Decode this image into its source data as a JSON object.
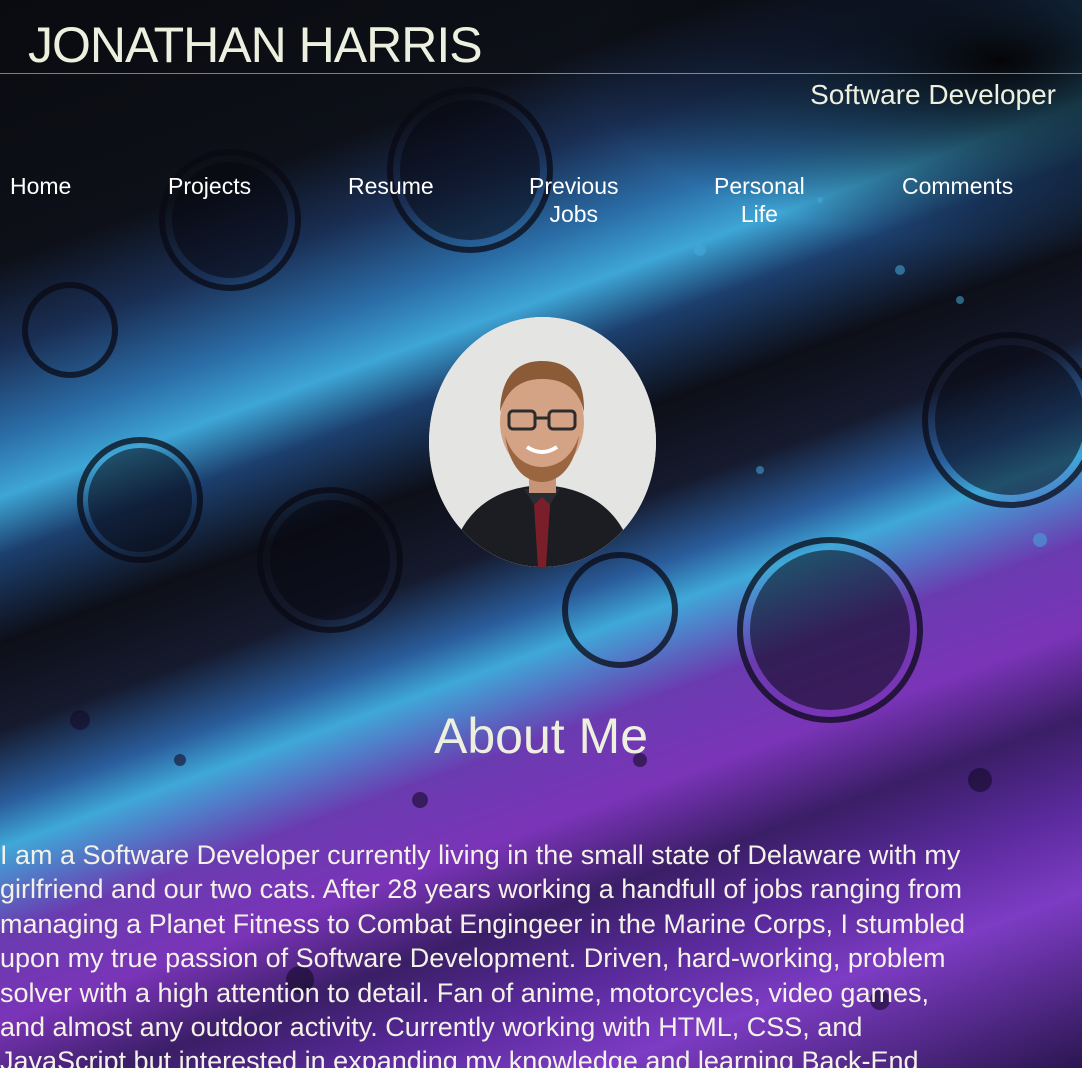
{
  "header": {
    "name": "JONATHAN HARRIS",
    "tagline": "Software Developer"
  },
  "nav": [
    {
      "label": "Home"
    },
    {
      "label": "Projects"
    },
    {
      "label": "Resume"
    },
    {
      "label": "Previous\nJobs"
    },
    {
      "label": "Personal\nLife"
    },
    {
      "label": "Comments"
    }
  ],
  "main": {
    "avatar_icon": "profile-photo",
    "section_title": "About Me",
    "bio_lines": [
      "I am a Software Developer currently living in the small state of Delaware with my",
      "girlfriend and our two cats. After 28 years working a handfull of jobs ranging from",
      "managing a Planet Fitness to Combat Engingeer in the Marine Corps, I stumbled",
      "upon my true passion of Software Development. Driven, hard-working, problem",
      "solver with a high attention to detail. Fan of anime, motorcycles, video games,",
      "and almost any outdoor activity. Currently working with HTML, CSS, and",
      "JavaScript but interested in expanding my knowledge and learning Back-End"
    ]
  },
  "colors": {
    "text": "#eef0df",
    "accent_blue": "#3ea6d6",
    "accent_purple": "#7a34b8"
  }
}
